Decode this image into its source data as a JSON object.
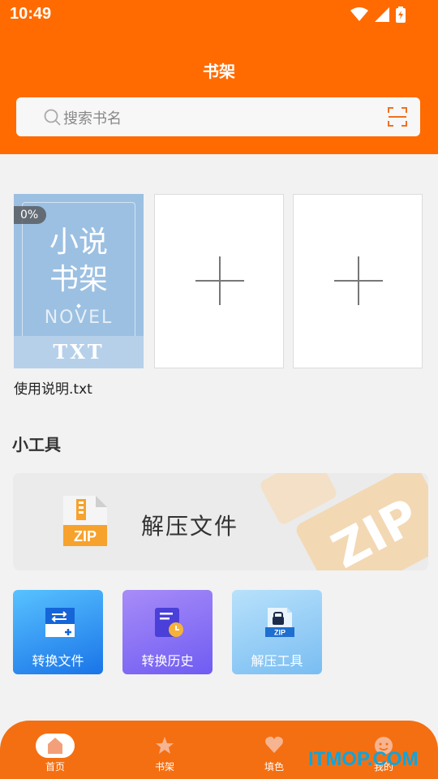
{
  "status_bar": {
    "time": "10:49"
  },
  "header": {
    "title": "书架"
  },
  "search": {
    "placeholder": "搜索书名"
  },
  "bookshelf": {
    "books": [
      {
        "progress": "0%",
        "cover_line1": "小说",
        "cover_line2": "书架",
        "cover_sub": "NOVEL",
        "cover_band": "TXT",
        "name": "使用说明.txt"
      }
    ]
  },
  "tools": {
    "title": "小工具",
    "unzip_card": {
      "label": "解压文件",
      "icon_text": "ZIP",
      "watermark_text": "ZIP"
    },
    "tiles": [
      {
        "label": "转换文件"
      },
      {
        "label": "转换历史"
      },
      {
        "label": "解压工具",
        "icon_text": "ZIP"
      }
    ]
  },
  "bottom_nav": {
    "items": [
      {
        "label": "首页"
      },
      {
        "label": "书架"
      },
      {
        "label": "填色"
      },
      {
        "label": "我的"
      }
    ]
  },
  "watermark": "ITMOP.COM",
  "colors": {
    "brand": "#ff6b00",
    "nav": "#f46f12"
  }
}
